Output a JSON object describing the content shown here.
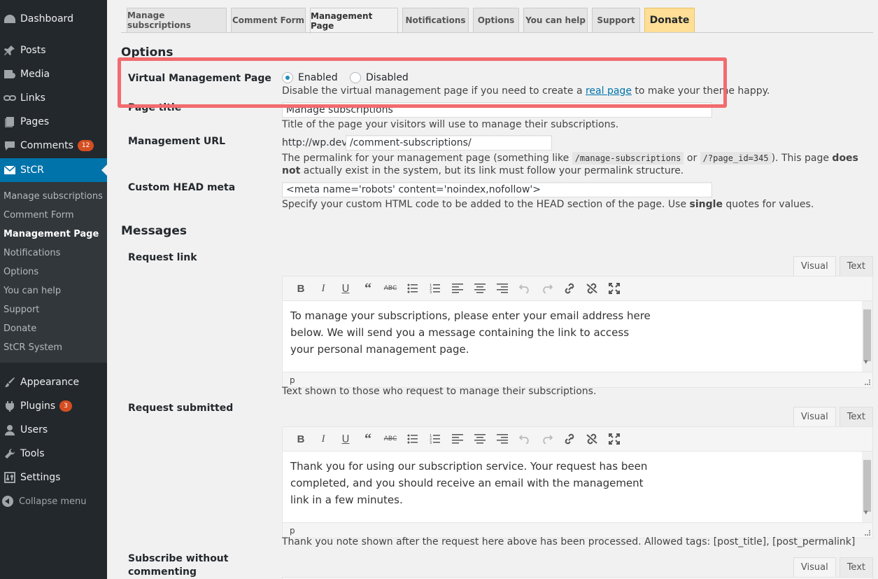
{
  "sidebar": {
    "menu": {
      "dashboard": "Dashboard",
      "posts": "Posts",
      "media": "Media",
      "links": "Links",
      "pages": "Pages",
      "comments": "Comments",
      "comments_badge": "12",
      "stcr": "StCR",
      "appearance": "Appearance",
      "plugins": "Plugins",
      "plugins_badge": "3",
      "users": "Users",
      "tools": "Tools",
      "settings": "Settings"
    },
    "submenu": [
      "Manage subscriptions",
      "Comment Form",
      "Management Page",
      "Notifications",
      "Options",
      "You can help",
      "Support",
      "Donate",
      "StCR System"
    ],
    "collapse": "Collapse menu"
  },
  "tabs": [
    "Manage subscriptions",
    "Comment Form",
    "Management Page",
    "Notifications",
    "Options",
    "You can help",
    "Support",
    "Donate"
  ],
  "options": {
    "heading": "Options",
    "vmp_label": "Virtual Management Page",
    "enabled": "Enabled",
    "disabled": "Disabled",
    "vmp_desc_pre": "Disable the virtual management page if you need to create a",
    "vmp_desc_link": "real page",
    "vmp_desc_post": "to make your theme happy.",
    "page_title_label": "Page title",
    "page_title_value": "Manage subscriptions",
    "page_title_desc": "Title of the page your visitors will use to manage their subscriptions.",
    "url_label": "Management URL",
    "url_prefix": "http://wp.dev",
    "url_value": "/comment-subscriptions/",
    "url_desc_1": "The permalink for your management page (something like",
    "url_code_1": "/manage-subscriptions",
    "url_desc_or": "or",
    "url_code_2": "/?page_id=345",
    "url_desc_2": "). This page",
    "url_desc_bold": "does not",
    "url_desc_3": "actually exist in the system, but its link must follow your permalink structure.",
    "head_label": "Custom HEAD meta",
    "head_value": "<meta name='robots' content='noindex,nofollow'>",
    "head_desc_1": "Specify your custom HTML code to be added to the HEAD section of the page. Use",
    "head_desc_bold": "single",
    "head_desc_2": "quotes for values."
  },
  "messages": {
    "heading": "Messages",
    "visual": "Visual",
    "text": "Text",
    "status_p": "p",
    "request_link": {
      "label": "Request link",
      "content": "To manage your subscriptions, please enter your email address here\nbelow. We will send you a message containing the link to access\nyour personal management page.",
      "desc": "Text shown to those who request to manage their subscriptions."
    },
    "request_submitted": {
      "label": "Request submitted",
      "content": "Thank you for using our subscription service. Your request has been\ncompleted, and you should receive an email with the management\nlink in a few minutes.",
      "desc": "Thank you note shown after the request here above has been processed. Allowed tags: [post_title], [post_permalink]"
    },
    "subscribe_without_commenting": {
      "label_1": "Subscribe without",
      "label_2": "commenting"
    }
  },
  "toolbar_icons": [
    "bold-icon",
    "italic-icon",
    "underline-icon",
    "blockquote-icon",
    "strikethrough-icon",
    "bullet-list-icon",
    "numbered-list-icon",
    "align-left-icon",
    "align-center-icon",
    "align-right-icon",
    "undo-icon",
    "redo-icon",
    "link-icon",
    "unlink-icon",
    "fullscreen-icon"
  ],
  "colors": {
    "sidebar_bg": "#23282d",
    "active_blue": "#0073aa",
    "highlight_red": "#f26b6e",
    "donate_yellow": "#ffde96"
  }
}
